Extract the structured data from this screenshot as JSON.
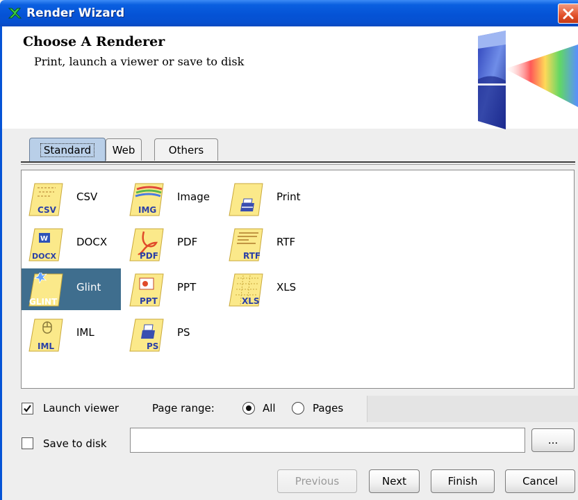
{
  "window": {
    "title": "Render Wizard"
  },
  "header": {
    "title": "Choose A Renderer",
    "subtitle": "Print, launch a viewer or save to disk"
  },
  "tabs": [
    {
      "label": "Standard",
      "active": true
    },
    {
      "label": "Web",
      "active": false
    },
    {
      "label": "Others",
      "active": false
    }
  ],
  "renderers": [
    {
      "label": "CSV",
      "icon_text": "CSV",
      "icon": "csv-icon"
    },
    {
      "label": "Image",
      "icon_text": "IMG",
      "icon": "image-icon"
    },
    {
      "label": "Print",
      "icon_text": "",
      "icon": "print-icon"
    },
    {
      "label": "DOCX",
      "icon_text": "DOCX",
      "icon": "docx-icon"
    },
    {
      "label": "PDF",
      "icon_text": "PDF",
      "icon": "pdf-icon"
    },
    {
      "label": "RTF",
      "icon_text": "RTF",
      "icon": "rtf-icon"
    },
    {
      "label": "Glint",
      "icon_text": "GLINT",
      "icon": "glint-icon",
      "selected": true
    },
    {
      "label": "PPT",
      "icon_text": "PPT",
      "icon": "ppt-icon"
    },
    {
      "label": "XLS",
      "icon_text": "XLS",
      "icon": "xls-icon"
    },
    {
      "label": "IML",
      "icon_text": "IML",
      "icon": "iml-icon"
    },
    {
      "label": "PS",
      "icon_text": "PS",
      "icon": "ps-icon"
    }
  ],
  "options": {
    "launch_viewer": {
      "label": "Launch viewer",
      "checked": true
    },
    "page_range_label": "Page range:",
    "range_all": {
      "label": "All",
      "selected": true
    },
    "range_pages": {
      "label": "Pages",
      "selected": false
    },
    "save_to_disk": {
      "label": "Save to disk",
      "checked": false
    },
    "path_value": "",
    "browse_label": "..."
  },
  "buttons": {
    "previous": "Previous",
    "next": "Next",
    "finish": "Finish",
    "cancel": "Cancel"
  },
  "colors": {
    "title_bar": "#0553d6",
    "selection": "#3f6e8e",
    "tab_active": "#b9cfe8",
    "close": "#e2502a"
  }
}
